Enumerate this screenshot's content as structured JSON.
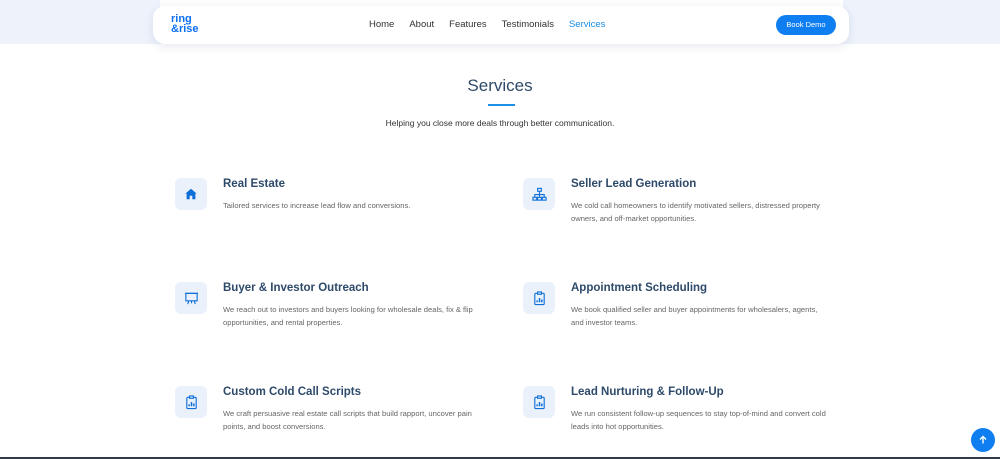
{
  "brand": {
    "logo_line1": "ring",
    "logo_line2": "&rise",
    "accent": "#0f7ef0"
  },
  "nav": {
    "links": [
      "Home",
      "About",
      "Features",
      "Testimonials",
      "Services"
    ],
    "active": "Services",
    "cta": "Book Demo"
  },
  "section": {
    "title": "Services",
    "subtitle": "Helping you close more deals through better communication."
  },
  "services": [
    {
      "title": "Real Estate",
      "desc": "Tailored services to increase lead flow and conversions.",
      "icon": "home-icon"
    },
    {
      "title": "Seller Lead Generation",
      "desc": "We cold call homeowners to identify motivated sellers, distressed property owners, and off-market opportunities.",
      "icon": "sitemap-icon"
    },
    {
      "title": "Buyer & Investor Outreach",
      "desc": "We reach out to investors and buyers looking for wholesale deals, fix & flip opportunities, and rental properties.",
      "icon": "presentation-icon"
    },
    {
      "title": "Appointment Scheduling",
      "desc": "We book qualified seller and buyer appointments for wholesalers, agents, and investor teams.",
      "icon": "clipboard-chart-icon"
    },
    {
      "title": "Custom Cold Call Scripts",
      "desc": "We craft persuasive real estate call scripts that build rapport, uncover pain points, and boost conversions.",
      "icon": "clipboard-chart-icon"
    },
    {
      "title": "Lead Nurturing & Follow-Up",
      "desc": "We run consistent follow-up sequences to stay top-of-mind and convert cold leads into hot opportunities.",
      "icon": "clipboard-chart-icon"
    }
  ],
  "scroll_top_icon": "arrow-up-icon"
}
